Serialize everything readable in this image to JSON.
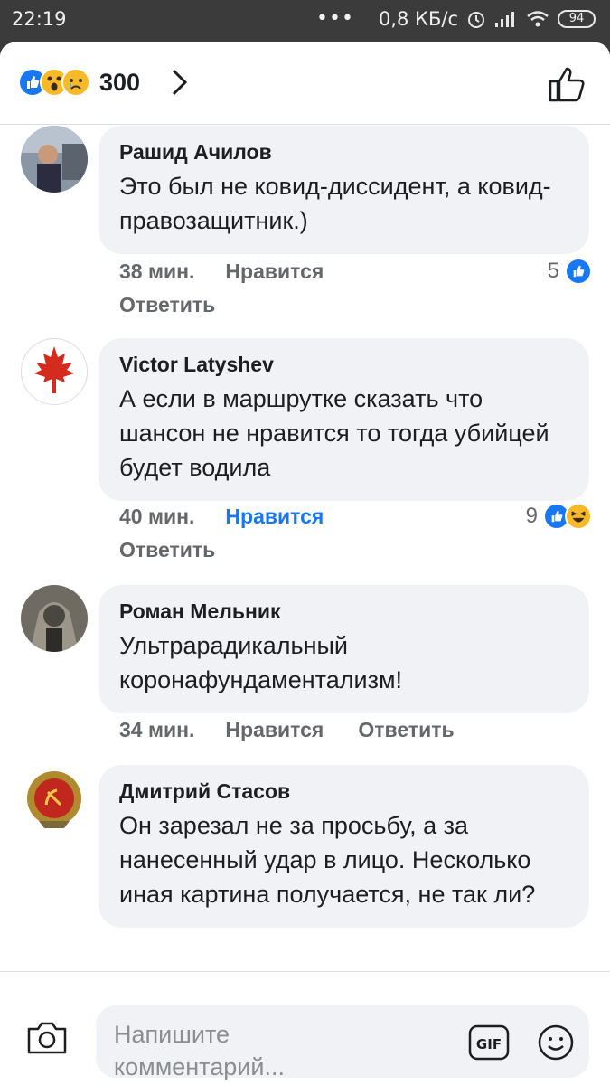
{
  "status": {
    "time": "22:19",
    "dots": "•••",
    "speed": "0,8 КБ/с",
    "battery": "94"
  },
  "header": {
    "reaction_count": "300",
    "reactions": [
      "like-icon",
      "wow-icon",
      "sad-icon"
    ]
  },
  "comments": [
    {
      "author": "Рашид Ачилов",
      "text": "Это был не ковид-диссидент, а ковид-правозащитник.)",
      "time": "38 мин.",
      "like": "Нравится",
      "reply": "Ответить",
      "reactions_count": "5",
      "liked": false
    },
    {
      "author": "Victor Latyshev",
      "text": "А если в маршрутке сказать что шансон не нравится то тогда убийцей будет водила",
      "time": "40 мин.",
      "like": "Нравится",
      "reply": "Ответить",
      "reactions_count": "9",
      "liked": true
    },
    {
      "author": "Роман Мельник",
      "text": "Ультрарадикальный коронафундаментализм!",
      "time": "34 мин.",
      "like": "Нравится",
      "reply": "Ответить"
    },
    {
      "author": "Дмитрий Стасов",
      "text": "Он зарезал не за просьбу, а за нанесенный удар в лицо. Несколько иная картина получается, не так ли?"
    }
  ],
  "composer": {
    "placeholder": "Напишите комментарий...",
    "gif_label": "GIF"
  },
  "colors": {
    "accent": "#1877f2",
    "bubble": "#f0f2f5",
    "meta": "#65676b"
  }
}
